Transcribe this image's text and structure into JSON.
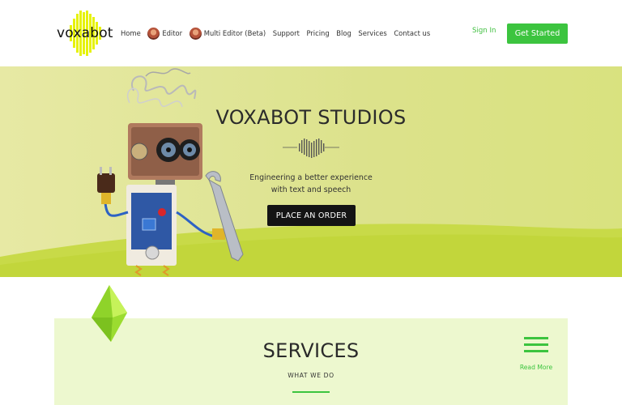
{
  "brand": {
    "name": "voxabot"
  },
  "nav": {
    "items": [
      {
        "label": "Home",
        "avatar": false
      },
      {
        "label": "Editor",
        "avatar": true
      },
      {
        "label": "Multi Editor (Beta)",
        "avatar": true
      },
      {
        "label": "Support",
        "avatar": false
      },
      {
        "label": "Pricing",
        "avatar": false
      },
      {
        "label": "Blog",
        "avatar": false
      },
      {
        "label": "Services",
        "avatar": false
      },
      {
        "label": "Contact us",
        "avatar": false
      }
    ],
    "sign_in": "Sign In",
    "get_started": "Get Started"
  },
  "hero": {
    "title": "VOXABOT STUDIOS",
    "subtitle_line1": "Engineering a better experience",
    "subtitle_line2": "with text and speech",
    "order_button": "PLACE AN ORDER",
    "icons": [
      "robot-illustration",
      "heart-waveform-icon"
    ]
  },
  "services": {
    "title": "SERVICES",
    "subtitle": "WHAT WE DO",
    "read_more": "Read More",
    "icons": [
      "gem-icon",
      "hamburger-menu-icon"
    ]
  },
  "colors": {
    "accent": "#3cc43f",
    "hero_bg": "#dfe495",
    "hero_wave": "#c6d94a",
    "services_bg": "#edf8cf",
    "logo_yellow": "#e6f20b",
    "button_dark": "#141414"
  }
}
